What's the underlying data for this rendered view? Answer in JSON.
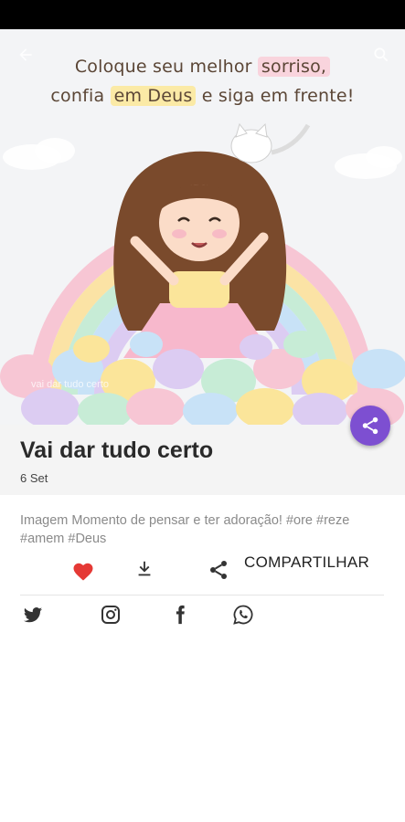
{
  "image": {
    "quote_line_1_start": "Coloque seu melhor ",
    "quote_line_1_highlight": "sorriso,",
    "quote_line_2_start": "confia ",
    "quote_line_2_highlight": "em Deus",
    "quote_line_2_end": " e siga em frente!",
    "watermark": "vai dar tudo certo",
    "colors": {
      "background": "#f3f4f6",
      "text": "#5b4636",
      "highlight_pink": "#f9d4dd",
      "highlight_yellow": "#fbeaa6"
    }
  },
  "post": {
    "title": "Vai dar tudo certo",
    "date": "6 Set",
    "description": "Imagem Momento de pensar e ter adoração! #ore #reze #amem #Deus"
  },
  "actions": {
    "share_label": "COMPARTILHAR",
    "like_icon": "heart-icon",
    "download_icon": "download-icon",
    "share_icon": "share-icon"
  },
  "social": {
    "icons": [
      "twitter-icon",
      "instagram-icon",
      "facebook-icon",
      "whatsapp-icon"
    ]
  },
  "colors": {
    "accent": "#7d4fd1",
    "like": "#e53935",
    "title": "#2a2a2a",
    "description": "#8a8a8a"
  }
}
